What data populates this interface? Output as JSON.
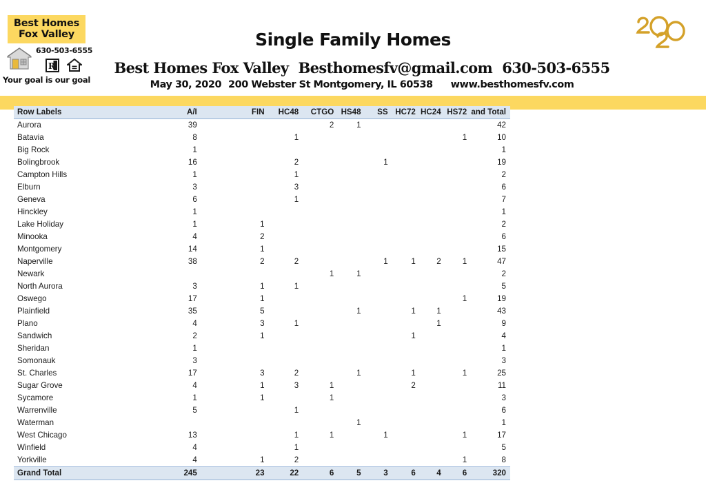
{
  "branding": {
    "logo_line1": "Best Homes",
    "logo_line2": "Fox Valley",
    "logo_phone": "630-503-6555",
    "logo_tagline": "Your goal is our goal",
    "logo_bg_color": "#fcd860",
    "year_mark": "2020",
    "year_mark_color": "#d4a129",
    "icons": [
      "house-icon",
      "realtor-r-icon",
      "equal-housing-icon"
    ]
  },
  "header": {
    "title": "Single Family Homes",
    "company": "Best Homes Fox Valley",
    "email": "Besthomesfv@gmail.com",
    "phone": "630-503-6555",
    "date": "May 30, 2020",
    "address": "200 Webster St Montgomery, IL 60538",
    "website": "www.besthomesfv.com",
    "band_color": "#fcd860"
  },
  "table": {
    "header_bg": "#dce6f1",
    "border_color": "#95b3d7",
    "columns": [
      "Row Labels",
      "A/I",
      "FIN",
      "HC48",
      "CTGO",
      "HS48",
      "SS",
      "HC72",
      "HC24",
      "HS72",
      "and Total"
    ],
    "rows": [
      {
        "label": "Aurora",
        "ai": "39",
        "fin": "",
        "hc48": "",
        "ctgo": "2",
        "hs48": "1",
        "ss": "",
        "hc72": "",
        "hc24": "",
        "hs72": "",
        "total": "42"
      },
      {
        "label": "Batavia",
        "ai": "8",
        "fin": "",
        "hc48": "1",
        "ctgo": "",
        "hs48": "",
        "ss": "",
        "hc72": "",
        "hc24": "",
        "hs72": "1",
        "total": "10"
      },
      {
        "label": "Big Rock",
        "ai": "1",
        "fin": "",
        "hc48": "",
        "ctgo": "",
        "hs48": "",
        "ss": "",
        "hc72": "",
        "hc24": "",
        "hs72": "",
        "total": "1"
      },
      {
        "label": "Bolingbrook",
        "ai": "16",
        "fin": "",
        "hc48": "2",
        "ctgo": "",
        "hs48": "",
        "ss": "1",
        "hc72": "",
        "hc24": "",
        "hs72": "",
        "total": "19"
      },
      {
        "label": "Campton Hills",
        "ai": "1",
        "fin": "",
        "hc48": "1",
        "ctgo": "",
        "hs48": "",
        "ss": "",
        "hc72": "",
        "hc24": "",
        "hs72": "",
        "total": "2"
      },
      {
        "label": "Elburn",
        "ai": "3",
        "fin": "",
        "hc48": "3",
        "ctgo": "",
        "hs48": "",
        "ss": "",
        "hc72": "",
        "hc24": "",
        "hs72": "",
        "total": "6"
      },
      {
        "label": "Geneva",
        "ai": "6",
        "fin": "",
        "hc48": "1",
        "ctgo": "",
        "hs48": "",
        "ss": "",
        "hc72": "",
        "hc24": "",
        "hs72": "",
        "total": "7"
      },
      {
        "label": "Hinckley",
        "ai": "1",
        "fin": "",
        "hc48": "",
        "ctgo": "",
        "hs48": "",
        "ss": "",
        "hc72": "",
        "hc24": "",
        "hs72": "",
        "total": "1"
      },
      {
        "label": "Lake Holiday",
        "ai": "1",
        "fin": "1",
        "hc48": "",
        "ctgo": "",
        "hs48": "",
        "ss": "",
        "hc72": "",
        "hc24": "",
        "hs72": "",
        "total": "2"
      },
      {
        "label": "Minooka",
        "ai": "4",
        "fin": "2",
        "hc48": "",
        "ctgo": "",
        "hs48": "",
        "ss": "",
        "hc72": "",
        "hc24": "",
        "hs72": "",
        "total": "6"
      },
      {
        "label": "Montgomery",
        "ai": "14",
        "fin": "1",
        "hc48": "",
        "ctgo": "",
        "hs48": "",
        "ss": "",
        "hc72": "",
        "hc24": "",
        "hs72": "",
        "total": "15"
      },
      {
        "label": "Naperville",
        "ai": "38",
        "fin": "2",
        "hc48": "2",
        "ctgo": "",
        "hs48": "",
        "ss": "1",
        "hc72": "1",
        "hc24": "2",
        "hs72": "1",
        "total": "47"
      },
      {
        "label": "Newark",
        "ai": "",
        "fin": "",
        "hc48": "",
        "ctgo": "1",
        "hs48": "1",
        "ss": "",
        "hc72": "",
        "hc24": "",
        "hs72": "",
        "total": "2"
      },
      {
        "label": "North Aurora",
        "ai": "3",
        "fin": "1",
        "hc48": "1",
        "ctgo": "",
        "hs48": "",
        "ss": "",
        "hc72": "",
        "hc24": "",
        "hs72": "",
        "total": "5"
      },
      {
        "label": "Oswego",
        "ai": "17",
        "fin": "1",
        "hc48": "",
        "ctgo": "",
        "hs48": "",
        "ss": "",
        "hc72": "",
        "hc24": "",
        "hs72": "1",
        "total": "19"
      },
      {
        "label": "Plainfield",
        "ai": "35",
        "fin": "5",
        "hc48": "",
        "ctgo": "",
        "hs48": "1",
        "ss": "",
        "hc72": "1",
        "hc24": "1",
        "hs72": "",
        "total": "43"
      },
      {
        "label": "Plano",
        "ai": "4",
        "fin": "3",
        "hc48": "1",
        "ctgo": "",
        "hs48": "",
        "ss": "",
        "hc72": "",
        "hc24": "1",
        "hs72": "",
        "total": "9"
      },
      {
        "label": "Sandwich",
        "ai": "2",
        "fin": "1",
        "hc48": "",
        "ctgo": "",
        "hs48": "",
        "ss": "",
        "hc72": "1",
        "hc24": "",
        "hs72": "",
        "total": "4"
      },
      {
        "label": "Sheridan",
        "ai": "1",
        "fin": "",
        "hc48": "",
        "ctgo": "",
        "hs48": "",
        "ss": "",
        "hc72": "",
        "hc24": "",
        "hs72": "",
        "total": "1"
      },
      {
        "label": "Somonauk",
        "ai": "3",
        "fin": "",
        "hc48": "",
        "ctgo": "",
        "hs48": "",
        "ss": "",
        "hc72": "",
        "hc24": "",
        "hs72": "",
        "total": "3"
      },
      {
        "label": "St. Charles",
        "ai": "17",
        "fin": "3",
        "hc48": "2",
        "ctgo": "",
        "hs48": "1",
        "ss": "",
        "hc72": "1",
        "hc24": "",
        "hs72": "1",
        "total": "25"
      },
      {
        "label": "Sugar Grove",
        "ai": "4",
        "fin": "1",
        "hc48": "3",
        "ctgo": "1",
        "hs48": "",
        "ss": "",
        "hc72": "2",
        "hc24": "",
        "hs72": "",
        "total": "11"
      },
      {
        "label": "Sycamore",
        "ai": "1",
        "fin": "1",
        "hc48": "",
        "ctgo": "1",
        "hs48": "",
        "ss": "",
        "hc72": "",
        "hc24": "",
        "hs72": "",
        "total": "3"
      },
      {
        "label": "Warrenville",
        "ai": "5",
        "fin": "",
        "hc48": "1",
        "ctgo": "",
        "hs48": "",
        "ss": "",
        "hc72": "",
        "hc24": "",
        "hs72": "",
        "total": "6"
      },
      {
        "label": "Waterman",
        "ai": "",
        "fin": "",
        "hc48": "",
        "ctgo": "",
        "hs48": "1",
        "ss": "",
        "hc72": "",
        "hc24": "",
        "hs72": "",
        "total": "1"
      },
      {
        "label": "West Chicago",
        "ai": "13",
        "fin": "",
        "hc48": "1",
        "ctgo": "1",
        "hs48": "",
        "ss": "1",
        "hc72": "",
        "hc24": "",
        "hs72": "1",
        "total": "17"
      },
      {
        "label": "Winfield",
        "ai": "4",
        "fin": "",
        "hc48": "1",
        "ctgo": "",
        "hs48": "",
        "ss": "",
        "hc72": "",
        "hc24": "",
        "hs72": "",
        "total": "5"
      },
      {
        "label": "Yorkville",
        "ai": "4",
        "fin": "1",
        "hc48": "2",
        "ctgo": "",
        "hs48": "",
        "ss": "",
        "hc72": "",
        "hc24": "",
        "hs72": "1",
        "total": "8"
      }
    ],
    "grand_total": {
      "label": "Grand Total",
      "ai": "245",
      "fin": "23",
      "hc48": "22",
      "ctgo": "6",
      "hs48": "5",
      "ss": "3",
      "hc72": "6",
      "hc24": "4",
      "hs72": "6",
      "total": "320"
    }
  },
  "chart_data": {
    "type": "table",
    "title": "Single Family Homes",
    "categories": [
      "Aurora",
      "Batavia",
      "Big Rock",
      "Bolingbrook",
      "Campton Hills",
      "Elburn",
      "Geneva",
      "Hinckley",
      "Lake Holiday",
      "Minooka",
      "Montgomery",
      "Naperville",
      "Newark",
      "North Aurora",
      "Oswego",
      "Plainfield",
      "Plano",
      "Sandwich",
      "Sheridan",
      "Somonauk",
      "St. Charles",
      "Sugar Grove",
      "Sycamore",
      "Warrenville",
      "Waterman",
      "West Chicago",
      "Winfield",
      "Yorkville"
    ],
    "series": [
      {
        "name": "A/I",
        "values": [
          39,
          8,
          1,
          16,
          1,
          3,
          6,
          1,
          1,
          4,
          14,
          38,
          0,
          3,
          17,
          35,
          4,
          2,
          1,
          3,
          17,
          4,
          1,
          5,
          0,
          13,
          4,
          4
        ],
        "total": 245
      },
      {
        "name": "FIN",
        "values": [
          0,
          0,
          0,
          0,
          0,
          0,
          0,
          0,
          1,
          2,
          1,
          2,
          0,
          1,
          1,
          5,
          3,
          1,
          0,
          0,
          3,
          1,
          1,
          0,
          0,
          0,
          0,
          1
        ],
        "total": 23
      },
      {
        "name": "HC48",
        "values": [
          0,
          1,
          0,
          2,
          1,
          3,
          1,
          0,
          0,
          0,
          0,
          2,
          0,
          1,
          0,
          0,
          1,
          0,
          0,
          0,
          2,
          3,
          0,
          1,
          0,
          1,
          1,
          2
        ],
        "total": 22
      },
      {
        "name": "CTGO",
        "values": [
          2,
          0,
          0,
          0,
          0,
          0,
          0,
          0,
          0,
          0,
          0,
          0,
          1,
          0,
          0,
          0,
          0,
          0,
          0,
          0,
          0,
          1,
          1,
          0,
          0,
          1,
          0,
          0
        ],
        "total": 6
      },
      {
        "name": "HS48",
        "values": [
          1,
          0,
          0,
          0,
          0,
          0,
          0,
          0,
          0,
          0,
          0,
          0,
          1,
          0,
          0,
          1,
          0,
          0,
          0,
          0,
          1,
          0,
          0,
          0,
          1,
          0,
          0,
          0
        ],
        "total": 5
      },
      {
        "name": "SS",
        "values": [
          0,
          0,
          0,
          1,
          0,
          0,
          0,
          0,
          0,
          0,
          0,
          1,
          0,
          0,
          0,
          0,
          0,
          0,
          0,
          0,
          0,
          0,
          0,
          0,
          0,
          1,
          0,
          0
        ],
        "total": 3
      },
      {
        "name": "HC72",
        "values": [
          0,
          0,
          0,
          0,
          0,
          0,
          0,
          0,
          0,
          0,
          0,
          1,
          0,
          0,
          0,
          1,
          0,
          1,
          0,
          0,
          1,
          2,
          0,
          0,
          0,
          0,
          0,
          0
        ],
        "total": 6
      },
      {
        "name": "HC24",
        "values": [
          0,
          0,
          0,
          0,
          0,
          0,
          0,
          0,
          0,
          0,
          0,
          2,
          0,
          0,
          0,
          1,
          1,
          0,
          0,
          0,
          0,
          0,
          0,
          0,
          0,
          0,
          0,
          0
        ],
        "total": 4
      },
      {
        "name": "HS72",
        "values": [
          0,
          1,
          0,
          0,
          0,
          0,
          0,
          0,
          0,
          0,
          0,
          1,
          0,
          0,
          1,
          0,
          0,
          0,
          0,
          0,
          1,
          0,
          0,
          0,
          0,
          1,
          0,
          1
        ],
        "total": 6
      },
      {
        "name": "and Total",
        "values": [
          42,
          10,
          1,
          19,
          2,
          6,
          7,
          1,
          2,
          6,
          15,
          47,
          2,
          5,
          19,
          43,
          9,
          4,
          1,
          3,
          25,
          11,
          3,
          6,
          1,
          17,
          5,
          8
        ],
        "total": 320
      }
    ],
    "xlabel": "Row Labels",
    "ylabel": "",
    "grid": false,
    "legend": "none"
  }
}
